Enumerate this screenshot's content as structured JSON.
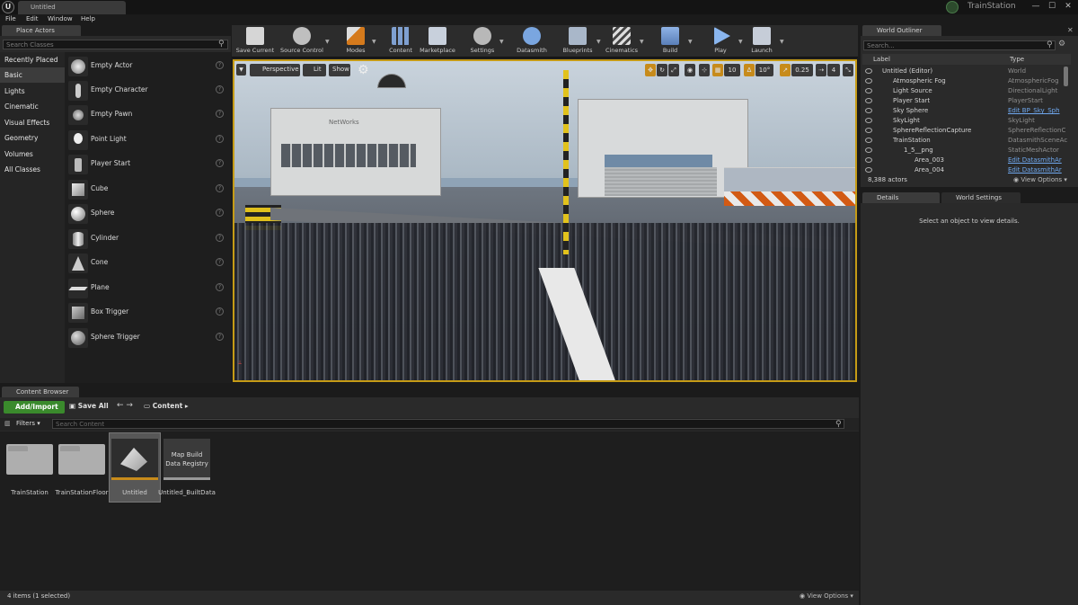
{
  "titlebar": {
    "doc_tab": "Untitled",
    "project": "TrainStation",
    "minimize": "—",
    "maximize": "☐",
    "close": "✕",
    "logo": "U"
  },
  "menu": [
    "File",
    "Edit",
    "Window",
    "Help"
  ],
  "place_actors": {
    "tab": "Place Actors",
    "search_placeholder": "Search Classes",
    "categories": [
      "Recently Placed",
      "Basic",
      "Lights",
      "Cinematic",
      "Visual Effects",
      "Geometry",
      "Volumes",
      "All Classes"
    ],
    "selected_category": "Basic",
    "actors": [
      "Empty Actor",
      "Empty Character",
      "Empty Pawn",
      "Point Light",
      "Player Start",
      "Cube",
      "Sphere",
      "Cylinder",
      "Cone",
      "Plane",
      "Box Trigger",
      "Sphere Trigger"
    ]
  },
  "toolbar": {
    "buttons": [
      "Save Current",
      "Source Control",
      "Modes",
      "Content",
      "Marketplace",
      "Settings",
      "Datasmith",
      "Blueprints",
      "Cinematics",
      "Build",
      "Play",
      "Launch"
    ]
  },
  "viewport": {
    "perspective": "Perspective",
    "lit": "Lit",
    "show": "Show",
    "grid_snap": "10",
    "rot_snap": "10°",
    "scale_snap": "0.25",
    "cam_speed": "4",
    "building_sign": "NetWorks"
  },
  "world_outliner": {
    "tab": "World Outliner",
    "search_placeholder": "Search...",
    "col_label": "Label",
    "col_type": "Type",
    "rows": [
      {
        "label": "Untitled (Editor)",
        "type": "World",
        "indent": 0,
        "link": false
      },
      {
        "label": "Atmospheric Fog",
        "type": "AtmosphericFog",
        "indent": 1,
        "link": false
      },
      {
        "label": "Light Source",
        "type": "DirectionalLight",
        "indent": 1,
        "link": false
      },
      {
        "label": "Player Start",
        "type": "PlayerStart",
        "indent": 1,
        "link": false
      },
      {
        "label": "Sky Sphere",
        "type": "Edit BP_Sky_Sph",
        "indent": 1,
        "link": true
      },
      {
        "label": "SkyLight",
        "type": "SkyLight",
        "indent": 1,
        "link": false
      },
      {
        "label": "SphereReflectionCapture",
        "type": "SphereReflectionC",
        "indent": 1,
        "link": false
      },
      {
        "label": "TrainStation",
        "type": "DatasmithSceneAc",
        "indent": 1,
        "link": false
      },
      {
        "label": "1_5__png",
        "type": "StaticMeshActor",
        "indent": 2,
        "link": false
      },
      {
        "label": "Area_003",
        "type": "Edit DatasmithAr",
        "indent": 3,
        "link": true
      },
      {
        "label": "Area_004",
        "type": "Edit DatasmithAr",
        "indent": 3,
        "link": true
      }
    ],
    "count": "8,388 actors",
    "view_options": "View Options"
  },
  "details": {
    "tab": "Details",
    "world_settings_tab": "World Settings",
    "message": "Select an object to view details."
  },
  "content_browser": {
    "tab": "Content Browser",
    "add_import": "Add/Import",
    "save_all": "Save All",
    "breadcrumb": "Content",
    "filters": "Filters",
    "search_placeholder": "Search Content",
    "assets": [
      {
        "name": "TrainStation",
        "kind": "folder"
      },
      {
        "name": "TrainStationFloor",
        "kind": "folder"
      },
      {
        "name": "Untitled",
        "kind": "level"
      },
      {
        "name": "Untitled_BuiltData",
        "kind": "data",
        "thumb_text": "Map Build Data Registry"
      }
    ],
    "status": "4 items (1 selected)",
    "view_options": "View Options"
  },
  "colors": {
    "accent": "#c78b1b",
    "add_button": "#3a8a2c",
    "link": "#6fa8ef"
  }
}
